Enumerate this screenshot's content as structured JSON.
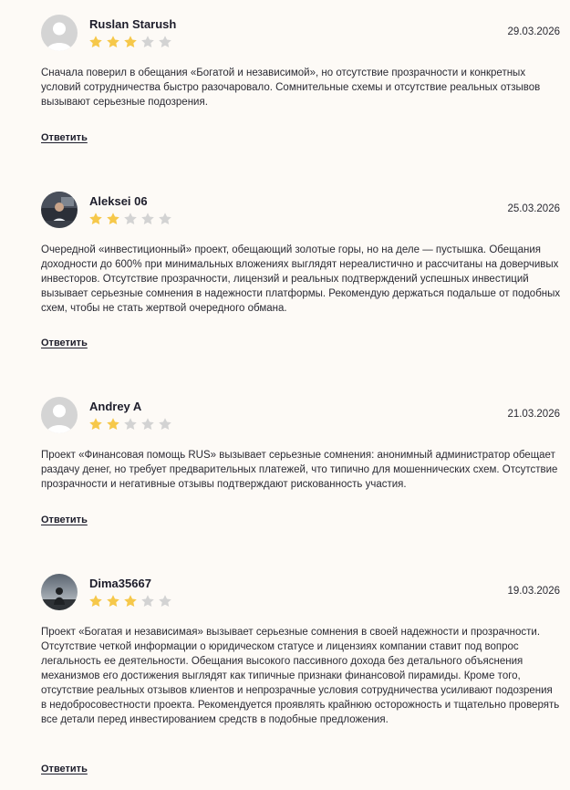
{
  "reviews": [
    {
      "author": "Ruslan Starush",
      "rating": 3,
      "max_rating": 5,
      "date": "29.03.2026",
      "avatar": "default-avatar",
      "text": "Сначала поверил в обещания «Богатой и независимой», но отсутствие прозрачности и конкретных условий сотрудничества быстро разочаровало. Сомнительные схемы и отсутствие реальных отзывов вызывают серьезные подозрения.",
      "reply_label": "Ответить"
    },
    {
      "author": "Aleksei 06",
      "rating": 2,
      "max_rating": 5,
      "date": "25.03.2026",
      "avatar": "photo-avatar",
      "text": "Очередной «инвестиционный» проект, обещающий золотые горы, но на деле — пустышка. Обещания доходности до 600% при минимальных вложениях выглядят нереалистично и рассчитаны на доверчивых инвесторов. Отсутствие прозрачности, лицензий и реальных подтверждений успешных инвестиций вызывает серьезные сомнения в надежности платформы. Рекомендую держаться подальше от подобных схем, чтобы не стать жертвой очередного обмана.",
      "reply_label": "Ответить"
    },
    {
      "author": "Andrey A",
      "rating": 2,
      "max_rating": 5,
      "date": "21.03.2026",
      "avatar": "default-avatar",
      "text": "Проект «Финансовая помощь RUS» вызывает серьезные сомнения: анонимный администратор обещает раздачу денег, но требует предварительных платежей, что типично для мошеннических схем. Отсутствие прозрачности и негативные отзывы подтверждают рискованность участия.",
      "reply_label": "Ответить"
    },
    {
      "author": "Dima35667",
      "rating": 3,
      "max_rating": 5,
      "date": "19.03.2026",
      "avatar": "photo-avatar",
      "text": "Проект «Богатая и независимая» вызывает серьезные сомнения в своей надежности и прозрачности. Отсутствие четкой информации о юридическом статусе и лицензиях компании ставит под вопрос легальность ее деятельности. Обещания высокого пассивного дохода без детального объяснения механизмов его достижения выглядят как типичные признаки финансовой пирамиды. Кроме того, отсутствие реальных отзывов клиентов и непрозрачные условия сотрудничества усиливают подозрения в недобросовестности проекта. Рекомендуется проявлять крайнюю осторожность и тщательно проверять все детали перед инвестированием средств в подобные предложения.",
      "reply_label": "Ответить"
    }
  ],
  "colors": {
    "background": "#fdfaf6",
    "star_filled": "#f6c84a",
    "star_empty": "#d3d3d3",
    "avatar_default": "#d4d4d4"
  }
}
